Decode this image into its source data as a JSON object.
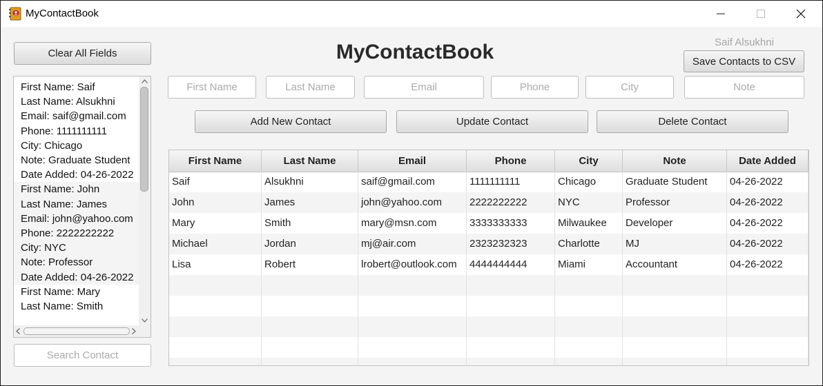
{
  "window": {
    "title": "MyContactBook"
  },
  "header": {
    "title": "MyContactBook",
    "user": "Saif Alsukhni"
  },
  "buttons": {
    "clear_all": "Clear All Fields",
    "save_csv": "Save Contacts to CSV",
    "add": "Add New Contact",
    "update": "Update Contact",
    "delete": "Delete Contact"
  },
  "form": {
    "first_name": "First Name",
    "last_name": "Last Name",
    "email": "Email",
    "phone": "Phone",
    "city": "City",
    "note": "Note"
  },
  "search": {
    "placeholder": "Search Contact"
  },
  "contact_list": [
    [
      "First Name: Saif",
      "Last Name: Alsukhni",
      "Email: saif@gmail.com",
      "Phone: 1111111111",
      "City: Chicago",
      "Note: Graduate Student",
      "Date Added: 04-26-2022"
    ],
    [
      "First Name: John",
      "Last Name: James",
      "Email: john@yahoo.com",
      "Phone: 2222222222",
      "City: NYC",
      "Note: Professor",
      "Date Added: 04-26-2022"
    ],
    [
      "First Name: Mary",
      "Last Name: Smith"
    ]
  ],
  "table": {
    "columns": [
      "First Name",
      "Last Name",
      "Email",
      "Phone",
      "City",
      "Note",
      "Date Added"
    ],
    "rows": [
      [
        "Saif",
        "Alsukhni",
        "saif@gmail.com",
        "1111111111",
        "Chicago",
        "Graduate Student",
        "04-26-2022"
      ],
      [
        "John",
        "James",
        "john@yahoo.com",
        "2222222222",
        "NYC",
        "Professor",
        "04-26-2022"
      ],
      [
        "Mary",
        "Smith",
        "mary@msn.com",
        "3333333333",
        "Milwaukee",
        "Developer",
        "04-26-2022"
      ],
      [
        "Michael",
        "Jordan",
        "mj@air.com",
        "2323232323",
        "Charlotte",
        "MJ",
        "04-26-2022"
      ],
      [
        "Lisa",
        "Robert",
        "lrobert@outlook.com",
        "4444444444",
        "Miami",
        "Accountant",
        "04-26-2022"
      ]
    ],
    "empty_rows": 5
  },
  "icons": {
    "app": "contact-book-icon",
    "minimize": "minimize-icon",
    "maximize": "maximize-icon",
    "close": "close-icon"
  }
}
